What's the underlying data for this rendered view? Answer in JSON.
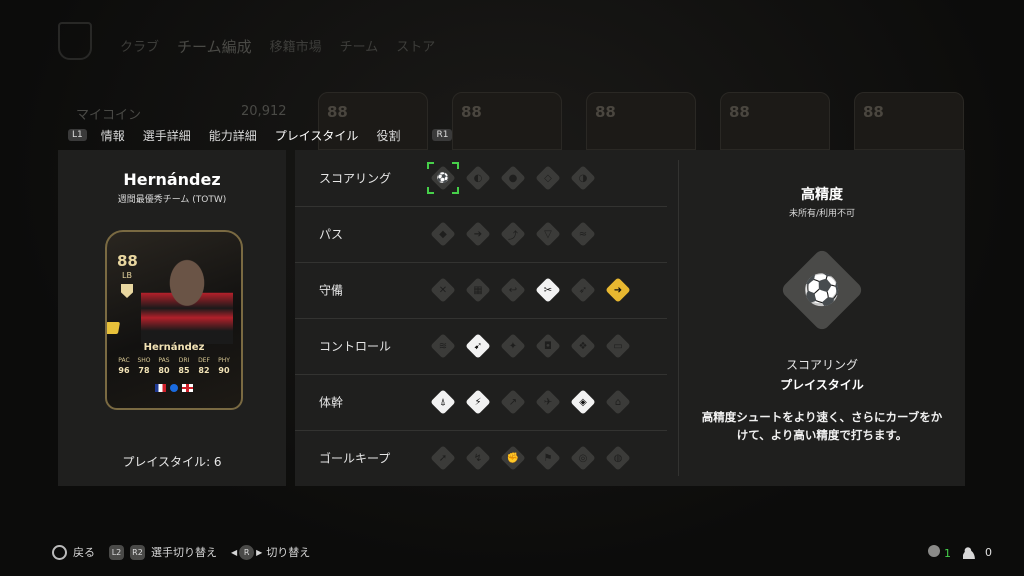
{
  "background": {
    "nav_items": [
      "クラブ",
      "チーム編成",
      "移籍市場",
      "チーム",
      "ストア"
    ],
    "coin_label": "マイコイン",
    "coin_value": "20,912",
    "card_ratings": [
      "88",
      "88",
      "88",
      "88",
      "88"
    ]
  },
  "tabs": {
    "left_button": "L1",
    "right_button": "R1",
    "items": [
      "情報",
      "選手詳細",
      "能力詳細",
      "プレイスタイル",
      "役割"
    ],
    "active": "プレイスタイル"
  },
  "player": {
    "name": "Hernández",
    "subtitle": "週間最優秀チーム (TOTW)",
    "card": {
      "rating": "88",
      "position": "LB",
      "name": "Hernández",
      "stats": [
        {
          "label": "PAC",
          "value": "96"
        },
        {
          "label": "SHO",
          "value": "78"
        },
        {
          "label": "PAS",
          "value": "80"
        },
        {
          "label": "DRI",
          "value": "85"
        },
        {
          "label": "DEF",
          "value": "82"
        },
        {
          "label": "PHY",
          "value": "90"
        }
      ]
    },
    "playstyle_count": "プレイスタイル: 6"
  },
  "categories": [
    {
      "label": "スコアリング",
      "icons": [
        {
          "name": "finesse-shot-icon",
          "glyph": "⚽",
          "state": "selected"
        },
        {
          "name": "chip-shot-icon",
          "glyph": "◐",
          "state": "none"
        },
        {
          "name": "power-shot-icon",
          "glyph": "●",
          "state": "none"
        },
        {
          "name": "dead-ball-icon",
          "glyph": "◇",
          "state": "none"
        },
        {
          "name": "power-header-icon",
          "glyph": "◑",
          "state": "none"
        }
      ]
    },
    {
      "label": "パス",
      "icons": [
        {
          "name": "incisive-pass-icon",
          "glyph": "◆",
          "state": "none"
        },
        {
          "name": "pinged-pass-icon",
          "glyph": "➔",
          "state": "none"
        },
        {
          "name": "long-ball-pass-icon",
          "glyph": "⤴",
          "state": "none"
        },
        {
          "name": "tiki-taka-icon",
          "glyph": "▽",
          "state": "none"
        },
        {
          "name": "whipped-pass-icon",
          "glyph": "≈",
          "state": "none"
        }
      ]
    },
    {
      "label": "守備",
      "icons": [
        {
          "name": "jockey-icon",
          "glyph": "✕",
          "state": "none"
        },
        {
          "name": "block-icon",
          "glyph": "▦",
          "state": "none"
        },
        {
          "name": "intercept-icon",
          "glyph": "↩",
          "state": "none"
        },
        {
          "name": "anticipate-icon",
          "glyph": "✂",
          "state": "owned"
        },
        {
          "name": "slide-tackle-icon",
          "glyph": "➶",
          "state": "none"
        },
        {
          "name": "bruiser-icon",
          "glyph": "➜",
          "state": "plus"
        }
      ]
    },
    {
      "label": "コントロール",
      "icons": [
        {
          "name": "technical-icon",
          "glyph": "≋",
          "state": "none"
        },
        {
          "name": "rapid-icon",
          "glyph": "➹",
          "state": "owned"
        },
        {
          "name": "flair-icon",
          "glyph": "✦",
          "state": "none"
        },
        {
          "name": "first-touch-icon",
          "glyph": "◘",
          "state": "none"
        },
        {
          "name": "trickster-icon",
          "glyph": "❖",
          "state": "none"
        },
        {
          "name": "press-proven-icon",
          "glyph": "▭",
          "state": "none"
        }
      ]
    },
    {
      "label": "体幹",
      "icons": [
        {
          "name": "quick-step-icon",
          "glyph": "⍋",
          "state": "owned"
        },
        {
          "name": "relentless-icon",
          "glyph": "⚡",
          "state": "owned"
        },
        {
          "name": "trivela-icon",
          "glyph": "↗",
          "state": "none"
        },
        {
          "name": "acrobatic-icon",
          "glyph": "✈",
          "state": "none"
        },
        {
          "name": "long-throw-icon",
          "glyph": "◈",
          "state": "owned"
        },
        {
          "name": "aerial-icon",
          "glyph": "⌂",
          "state": "none"
        }
      ]
    },
    {
      "label": "ゴールキープ",
      "icons": [
        {
          "name": "far-throw-icon",
          "glyph": "➚",
          "state": "none"
        },
        {
          "name": "footwork-icon",
          "glyph": "↯",
          "state": "none"
        },
        {
          "name": "cross-claimer-icon",
          "glyph": "✊",
          "state": "none"
        },
        {
          "name": "rush-out-icon",
          "glyph": "⚑",
          "state": "none"
        },
        {
          "name": "far-reach-icon",
          "glyph": "◎",
          "state": "none"
        },
        {
          "name": "deflector-icon",
          "glyph": "◍",
          "state": "none"
        }
      ]
    }
  ],
  "detail": {
    "title": "高精度",
    "subtitle": "未所有/利用不可",
    "icon": "finesse-shot-icon",
    "icon_glyph": "⚽",
    "category": "スコアリング",
    "type": "プレイスタイル",
    "description": "高精度シュートをより速く、さらにカーブをかけて、より高い精度で打ちます。"
  },
  "footer": {
    "back_label": "戻る",
    "switch_player_buttons": [
      "L2",
      "R2"
    ],
    "switch_player_label": "選手切り替え",
    "toggle_button": "R",
    "toggle_label": "切り替え",
    "status_count": "1",
    "users_count": "0"
  },
  "colors": {
    "selection": "#46d04a",
    "plus": "#e8b830",
    "owned": "#f2f2f2",
    "unowned": "#3b3b39",
    "panel": "#1f1f1e"
  }
}
